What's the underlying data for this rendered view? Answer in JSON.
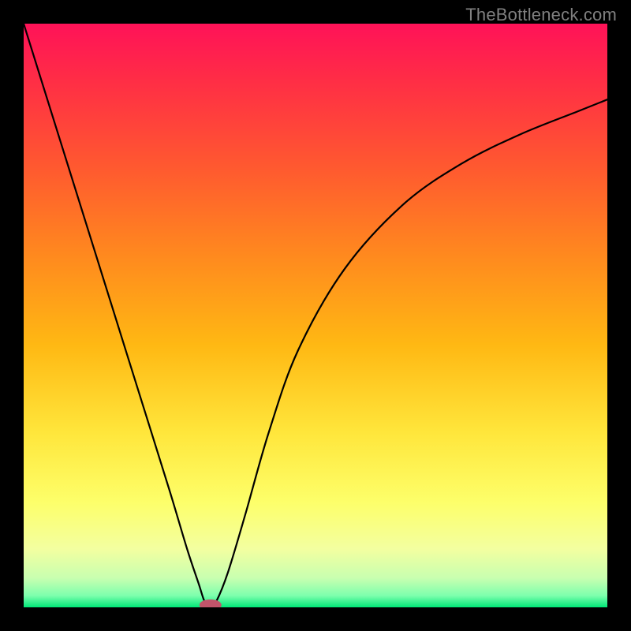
{
  "watermark": "TheBottleneck.com",
  "chart_data": {
    "type": "line",
    "title": "",
    "xlabel": "",
    "ylabel": "",
    "xlim": [
      0,
      1
    ],
    "ylim": [
      0,
      1
    ],
    "series": [
      {
        "name": "curve",
        "x": [
          0.0,
          0.05,
          0.1,
          0.15,
          0.2,
          0.25,
          0.28,
          0.3,
          0.31,
          0.32,
          0.33,
          0.35,
          0.38,
          0.42,
          0.47,
          0.55,
          0.65,
          0.75,
          0.85,
          0.95,
          1.0
        ],
        "y": [
          1.0,
          0.84,
          0.68,
          0.52,
          0.36,
          0.2,
          0.1,
          0.04,
          0.01,
          0.0,
          0.01,
          0.06,
          0.16,
          0.3,
          0.44,
          0.58,
          0.69,
          0.76,
          0.81,
          0.85,
          0.87
        ]
      }
    ],
    "minimum_marker": {
      "x": 0.32,
      "y": 0.0
    },
    "gradient_stops": [
      {
        "offset": 0.0,
        "color": "#ff1258"
      },
      {
        "offset": 0.1,
        "color": "#ff2e45"
      },
      {
        "offset": 0.25,
        "color": "#ff5a2f"
      },
      {
        "offset": 0.4,
        "color": "#ff8a1e"
      },
      {
        "offset": 0.55,
        "color": "#ffb813"
      },
      {
        "offset": 0.7,
        "color": "#ffe63b"
      },
      {
        "offset": 0.82,
        "color": "#fdff6a"
      },
      {
        "offset": 0.9,
        "color": "#f3ffa0"
      },
      {
        "offset": 0.95,
        "color": "#c8ffb0"
      },
      {
        "offset": 0.98,
        "color": "#7dffad"
      },
      {
        "offset": 1.0,
        "color": "#00e878"
      }
    ]
  }
}
